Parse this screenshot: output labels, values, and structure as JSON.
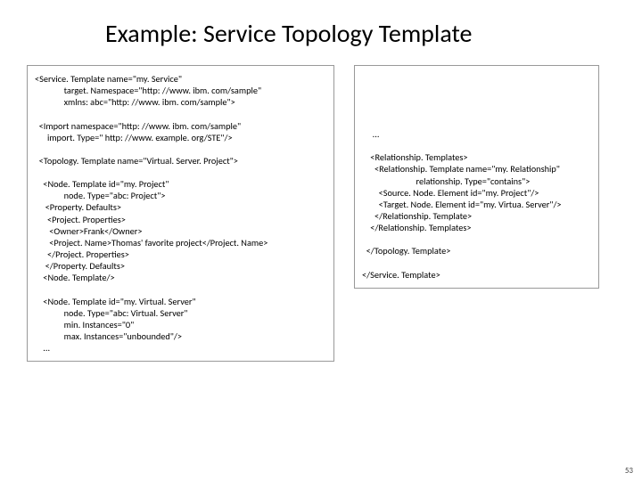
{
  "title": "Example: Service Topology Template",
  "left": {
    "l01": "<Service. Template name=\"my. Service\"",
    "l02": "              target. Namespace=\"http: //www. ibm. com/sample\"",
    "l03": "              xmlns: abc=\"http: //www. ibm. com/sample\">",
    "l04": "  <Import namespace=\"http: //www. ibm. com/sample\"",
    "l05": "      import. Type=\" http: //www. example. org/STE\"/>",
    "l06": "  <Topology. Template name=\"Virtual. Server. Project\">",
    "l07": "    <Node. Template id=\"my. Project\"",
    "l08": "              node. Type=\"abc: Project\">",
    "l09": "     <Property. Defaults>",
    "l10": "      <Project. Properties>",
    "l11": "       <Owner>Frank</Owner>",
    "l12": "       <Project. Name>Thomas' favorite project</Project. Name>",
    "l13": "      </Project. Properties>",
    "l14": "     </Property. Defaults>",
    "l15": "    <Node. Template/>",
    "l16": "    <Node. Template id=\"my. Virtual. Server\"",
    "l17": "              node. Type=\"abc: Virtual. Server\"",
    "l18": "              min. Instances=\"0\"",
    "l19": "              max. Instances=\"unbounded\"/>",
    "l20": "    ..."
  },
  "right": {
    "r00": "     ...",
    "r01": "    <Relationship. Templates>",
    "r02": "      <Relationship. Template name=\"my. Relationship\"",
    "r03": "                          relationship. Type=\"contains\">",
    "r04": "        <Source. Node. Element id=\"my. Project\"/>",
    "r05": "        <Target. Node. Element id=\"my. Virtua. Server\"/>",
    "r06": "      </Relationship. Template>",
    "r07": "    </Relationship. Templates>",
    "r08": "  </Topology. Template>",
    "r09": "</Service. Template>"
  },
  "pageNumber": "53"
}
